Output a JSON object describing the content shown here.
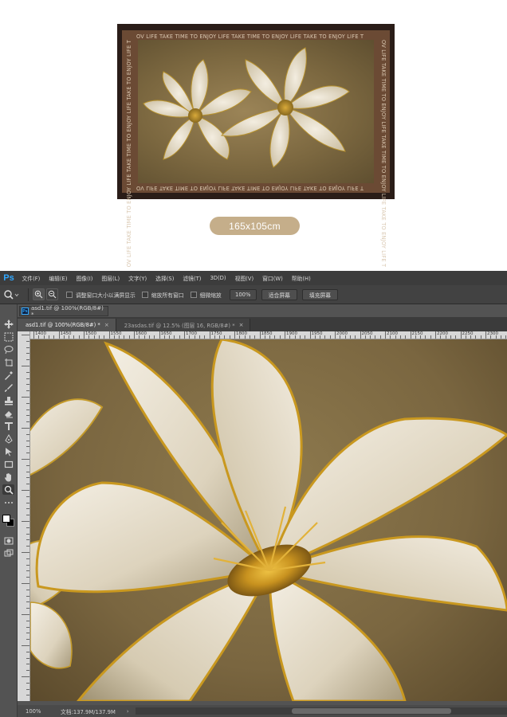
{
  "product": {
    "border_text": "OV LIFE TAKE TIME TO ENJOY LIFE TAKE TIME TO ENJOY LIFE TAKE TO ENJOY LIFE T",
    "size_label": "165x105cm"
  },
  "photoshop": {
    "app_logo": "Ps",
    "menu": [
      "文件(F)",
      "编辑(E)",
      "图像(I)",
      "图层(L)",
      "文字(Y)",
      "选择(S)",
      "滤镜(T)",
      "3D(D)",
      "视图(V)",
      "窗口(W)",
      "帮助(H)"
    ],
    "options": {
      "checkbox_resize": "调整窗口大小以满屏显示",
      "checkbox_all": "缩放所有窗口",
      "checkbox_scrubby": "细微缩放",
      "zoom_value": "100%",
      "fit_screen": "适合屏幕",
      "fill_screen": "填充屏幕"
    },
    "floating_tab": "asd1.tif @ 100%(RGB/8#) *",
    "tabs": [
      {
        "label": "asd1.tif @ 100%(RGB/8#) *",
        "close": "×"
      },
      {
        "label": "23asdas.tif @ 12.5% (图层 16, RGB/8#) *",
        "close": "×"
      }
    ],
    "ruler_labels": [
      "1400",
      "1450",
      "1500",
      "1550",
      "1600",
      "1650",
      "1700",
      "1750",
      "1800",
      "1850",
      "1900",
      "1950",
      "2000",
      "2050",
      "2100",
      "2150",
      "2200",
      "2250",
      "2300"
    ],
    "status": {
      "zoom": "100%",
      "doc": "文档:137.9M/137.9M",
      "arrow": "›"
    }
  }
}
